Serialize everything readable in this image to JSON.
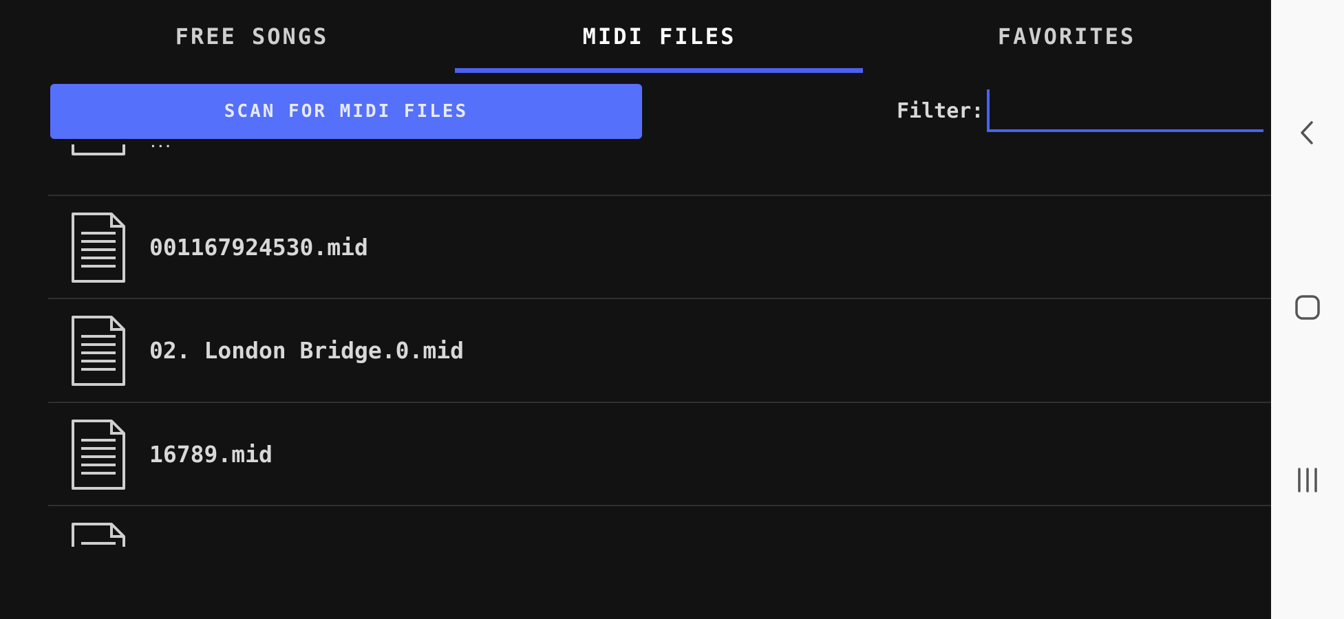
{
  "tabs": [
    {
      "label": "FREE SONGS",
      "active": false
    },
    {
      "label": "MIDI FILES",
      "active": true
    },
    {
      "label": "FAVORITES",
      "active": false
    }
  ],
  "scan_button": {
    "label": "SCAN FOR MIDI FILES"
  },
  "filter": {
    "label": "Filter:",
    "value": ""
  },
  "files": [
    {
      "name": "...",
      "icon": "document-icon"
    },
    {
      "name": "001167924530.mid",
      "icon": "document-icon"
    },
    {
      "name": "02. London Bridge.0.mid",
      "icon": "document-icon"
    },
    {
      "name": "16789.mid",
      "icon": "document-icon"
    },
    {
      "name": "",
      "icon": "document-icon"
    }
  ],
  "system_nav": [
    "back-icon",
    "home-icon",
    "recents-icon"
  ],
  "colors": {
    "background": "#121213",
    "accent": "#4a62f2",
    "button": "#5570fa",
    "text": "#d8d8d8",
    "nav_bar": "#f9f9f9"
  }
}
